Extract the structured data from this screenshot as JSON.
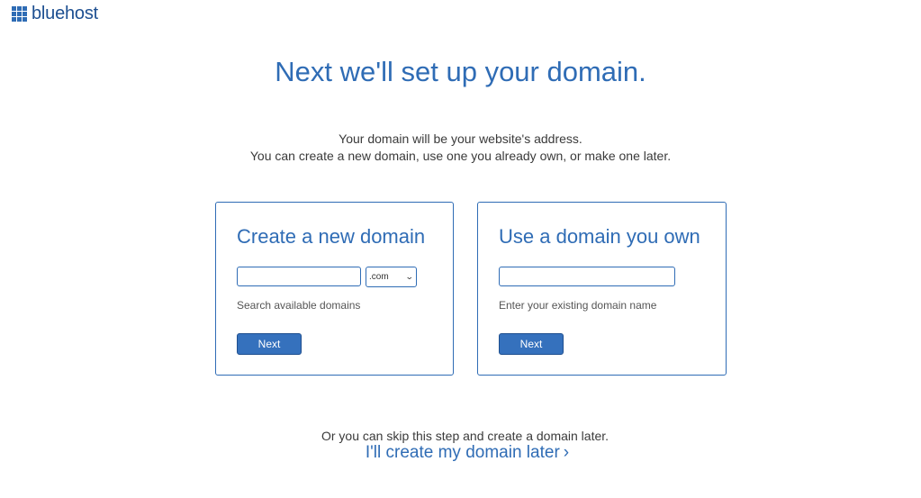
{
  "brand": {
    "name": "bluehost",
    "color": "#2f6cb5",
    "icon": "grid-logo-icon"
  },
  "page": {
    "title": "Next we'll set up your domain.",
    "subtitle_line1": "Your domain will be your website's address.",
    "subtitle_line2": "You can create a new domain, use one you already own, or make one later."
  },
  "new_domain": {
    "heading": "Create a new domain",
    "input_value": "",
    "tld_selected": ".com",
    "helper": "Search available domains",
    "button_label": "Next"
  },
  "own_domain": {
    "heading": "Use a domain you own",
    "input_value": "",
    "helper": "Enter your existing domain name",
    "button_label": "Next"
  },
  "skip": {
    "text": "Or you can skip this step and create a domain later.",
    "link_label": "I'll create my domain later",
    "link_icon": "chevron-right-icon"
  }
}
